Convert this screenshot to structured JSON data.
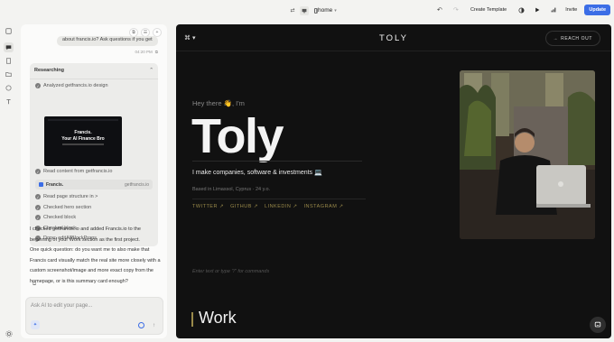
{
  "rail": {
    "icons": [
      "home-icon",
      "chat-icon",
      "page-icon",
      "files-icon",
      "palette-icon",
      "text-icon",
      "settings-icon"
    ]
  },
  "topbar": {
    "page_name": "home",
    "template_label": "Create Template",
    "invite_label": "Invite",
    "update_label": "Update",
    "colors": {
      "update_bg": "#3b6de6"
    }
  },
  "chat": {
    "user_message": "about francis.io? Ask questions if you get",
    "user_time": "04:20 PM",
    "research": {
      "title": "Researching",
      "steps": [
        "Analyzed getfrancis.io design",
        "Read content from getfrancis.io",
        "Read page structure in >",
        "Checked hero section",
        "Checked block",
        "Checked block",
        "Done: editAllBlockProps"
      ],
      "preview": {
        "line1": "Francis.",
        "line2": "Your AI Finance Bro"
      },
      "file_chip": {
        "name": "Francis.",
        "domain": "getfrancis.io"
      }
    },
    "reply_1": "I checked getfrancis.io and added Francis.io to the beginning of your Work section as the first project.",
    "reply_2": "One quick question: do you want me to also make that Francis card visually match the real site more closely with a custom screenshot/image and more exact copy from the homepage, or is this summary card enough?",
    "composer_placeholder": "Ask AI to edit your page..."
  },
  "site": {
    "menu_glyph": "⌘ ▾",
    "logo": "TOLY",
    "reach_out": "REACH OUT",
    "greeting": "Hey there 👋, I'm",
    "name": "Toly",
    "tagline": "I make companies, software & investments 💻",
    "location": "Based in Limassol, Cyprus · 24 y.o.",
    "socials": [
      "TWITTER ↗",
      "GITHUB ↗",
      "LINKEDIN ↗",
      "INSTAGRAM ↗"
    ],
    "command_hint": "Enter text or type \"/\" for commands",
    "section_title": "Work",
    "colors": {
      "accent": "#9a8a4a",
      "background": "#111111"
    }
  }
}
